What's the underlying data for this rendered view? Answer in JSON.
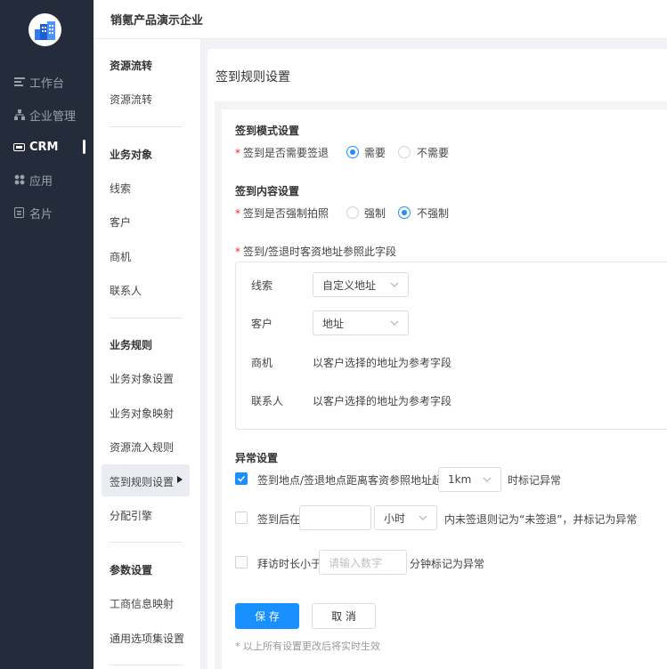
{
  "rail": {
    "items": [
      {
        "label": "工作台",
        "icon": "align-left-icon"
      },
      {
        "label": "企业管理",
        "icon": "org-tree-icon"
      },
      {
        "label": "CRM",
        "icon": "crm-badge-icon"
      },
      {
        "label": "应用",
        "icon": "apps-icon"
      },
      {
        "label": "名片",
        "icon": "card-icon"
      }
    ]
  },
  "header": {
    "company": "销氪产品演示企业"
  },
  "subnav": {
    "groups": [
      {
        "title": "资源流转",
        "items": [
          "资源流转"
        ]
      },
      {
        "title": "业务对象",
        "items": [
          "线索",
          "客户",
          "商机",
          "联系人"
        ]
      },
      {
        "title": "业务规则",
        "items": [
          "业务对象设置",
          "业务对象映射",
          "资源流入规则",
          "签到规则设置",
          "分配引擎"
        ]
      },
      {
        "title": "参数设置",
        "items": [
          "工商信息映射",
          "通用选项集设置"
        ]
      }
    ],
    "active": "签到规则设置"
  },
  "page": {
    "title": "签到规则设置"
  },
  "mode_section": {
    "title": "签到模式设置",
    "question": "签到是否需要签退",
    "options": [
      "需要",
      "不需要"
    ],
    "selected": "需要"
  },
  "content_section": {
    "title": "签到内容设置",
    "question": "签到是否强制拍照",
    "options": [
      "强制",
      "不强制"
    ],
    "selected": "不强制",
    "address_label": "签到/签退时客资地址参照此字段",
    "rows": [
      {
        "name": "线索",
        "type": "select",
        "value": "自定义地址"
      },
      {
        "name": "客户",
        "type": "select",
        "value": "地址"
      },
      {
        "name": "商机",
        "type": "text",
        "value": "以客户选择的地址为参考字段"
      },
      {
        "name": "联系人",
        "type": "text",
        "value": "以客户选择的地址为参考字段"
      }
    ]
  },
  "exception_section": {
    "title": "异常设置",
    "rule1": {
      "checked": true,
      "prefix": "签到地点/签退地点距离客资参照地址超过",
      "value": "1km",
      "suffix": "时标记异常"
    },
    "rule2": {
      "checked": false,
      "prefix": "签到后在",
      "input": "",
      "unit": "小时",
      "suffix": "内未签退则记为“未签退”，并标记为异常"
    },
    "rule3": {
      "checked": false,
      "prefix": "拜访时长小于",
      "placeholder": "请输入数字",
      "suffix": "分钟标记为异常"
    }
  },
  "actions": {
    "save": "保 存",
    "cancel": "取 消"
  },
  "footnote": "* 以上所有设置更改后将实时生效",
  "colors": {
    "primary": "#1890ff",
    "rail_bg": "#242b3a",
    "required": "#f5222d"
  }
}
